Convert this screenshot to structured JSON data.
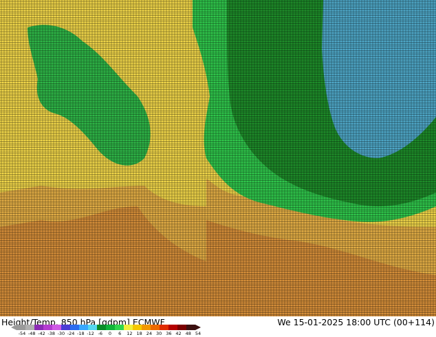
{
  "header": {
    "title": "Height/Temp. 850 hPa [gdpm] ECMWF",
    "valid_time": "We 15-01-2025 18:00 UTC (00+114)"
  },
  "colorbar": {
    "tick_labels": [
      "-54",
      "-48",
      "-42",
      "-38",
      "-30",
      "-24",
      "-18",
      "-12",
      "-6",
      "0",
      "6",
      "12",
      "18",
      "24",
      "30",
      "36",
      "42",
      "48",
      "54"
    ],
    "colors": [
      "#9a9a9a",
      "#b0b0b0",
      "#8c2bb5",
      "#b43cd0",
      "#d05ae6",
      "#4b3cd6",
      "#2a6cf0",
      "#38a8ff",
      "#55d8f0",
      "#0a8c28",
      "#10b43a",
      "#2fd64e",
      "#f0f03c",
      "#f5c800",
      "#f29800",
      "#ee6a00",
      "#e02a00",
      "#b40000",
      "#7a0000",
      "#3c1010"
    ]
  },
  "map": {
    "regions": [
      {
        "name": "cold-airmass",
        "color": "#4fa8c8"
      },
      {
        "name": "cool-green",
        "color": "#1e8e2a"
      },
      {
        "name": "green",
        "color": "#2cc84a"
      },
      {
        "name": "yellow",
        "color": "#f2e040"
      },
      {
        "name": "orange",
        "color": "#e0a840"
      },
      {
        "name": "warm-brown",
        "color": "#c07a30"
      }
    ]
  }
}
